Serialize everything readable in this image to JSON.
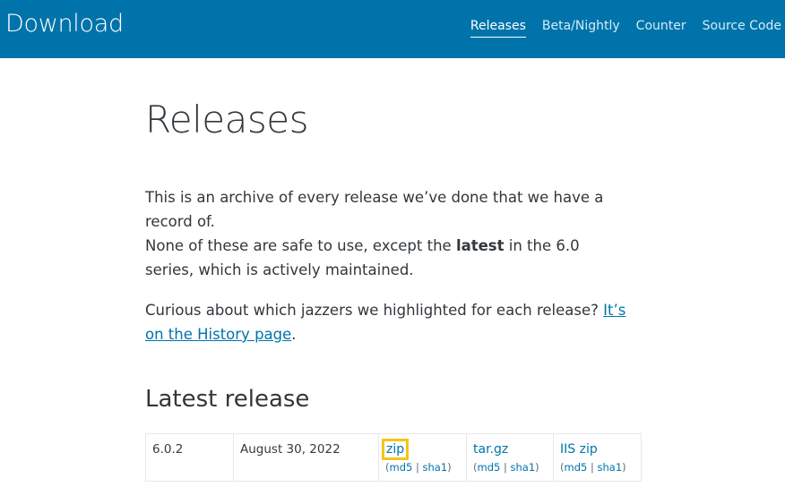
{
  "header": {
    "title": "Download",
    "nav": [
      {
        "label": "Releases",
        "active": true
      },
      {
        "label": "Beta/Nightly",
        "active": false
      },
      {
        "label": "Counter",
        "active": false
      },
      {
        "label": "Source Code",
        "active": false
      }
    ],
    "background_color": "#0073aa"
  },
  "main": {
    "title": "Releases",
    "intro": {
      "line1": "This is an archive of every release we’ve done that we have a record of.",
      "line2_before": "None of these are safe to use, except the ",
      "line2_bold": "latest",
      "line2_after": " in the 6.0 series, which is actively maintained."
    },
    "history": {
      "text": "Curious about which jazzers we highlighted for each release? ",
      "link": "It’s on the History page",
      "after": "."
    },
    "latest_heading": "Latest release",
    "latest_release": {
      "version": "6.0.2",
      "date": "August 30, 2022",
      "downloads": [
        {
          "label": "zip",
          "md5": "md5",
          "sep": "|",
          "sha1": "sha1",
          "highlighted": true
        },
        {
          "label": "tar.gz",
          "md5": "md5",
          "sep": "|",
          "sha1": "sha1",
          "highlighted": false
        },
        {
          "label": "IIS zip",
          "md5": "md5",
          "sep": "|",
          "sha1": "sha1",
          "highlighted": false
        }
      ]
    }
  },
  "colors": {
    "link": "#0073aa",
    "highlight_outline": "#f6c419"
  }
}
